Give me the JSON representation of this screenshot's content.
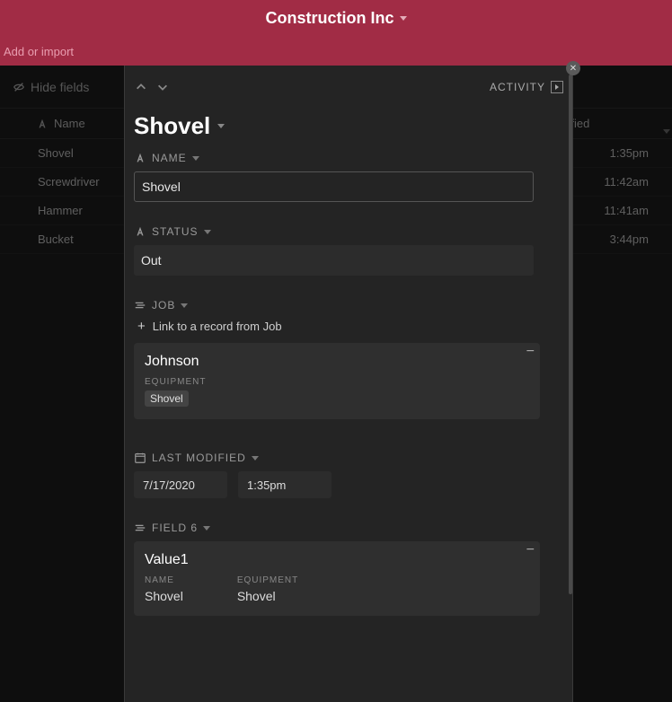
{
  "brand": {
    "name": "Construction Inc"
  },
  "secondbar": {
    "add_import": "Add or import"
  },
  "toolbar": {
    "hide_fields": "Hide fields"
  },
  "grid": {
    "columns": {
      "name": "Name",
      "modified": "odified"
    },
    "rows": [
      {
        "name": "Shovel",
        "time": "1:35pm"
      },
      {
        "name": "Screwdriver",
        "time": "11:42am"
      },
      {
        "name": "Hammer",
        "time": "11:41am"
      },
      {
        "name": "Bucket",
        "time": "3:44pm"
      }
    ]
  },
  "panel": {
    "activity_label": "ACTIVITY",
    "title": "Shovel",
    "fields": {
      "name": {
        "label": "NAME",
        "value": "Shovel"
      },
      "status": {
        "label": "STATUS",
        "value": "Out"
      },
      "job": {
        "label": "JOB",
        "link_text": "Link to a record from Job",
        "card": {
          "title": "Johnson",
          "sub_label": "EQUIPMENT",
          "chip": "Shovel"
        }
      },
      "last_modified": {
        "label": "LAST MODIFIED",
        "date": "7/17/2020",
        "time": "1:35pm"
      },
      "field6": {
        "label": "FIELD 6",
        "card": {
          "title": "Value1",
          "cols": [
            {
              "label": "NAME",
              "value": "Shovel"
            },
            {
              "label": "EQUIPMENT",
              "value": "Shovel"
            }
          ]
        }
      }
    }
  }
}
